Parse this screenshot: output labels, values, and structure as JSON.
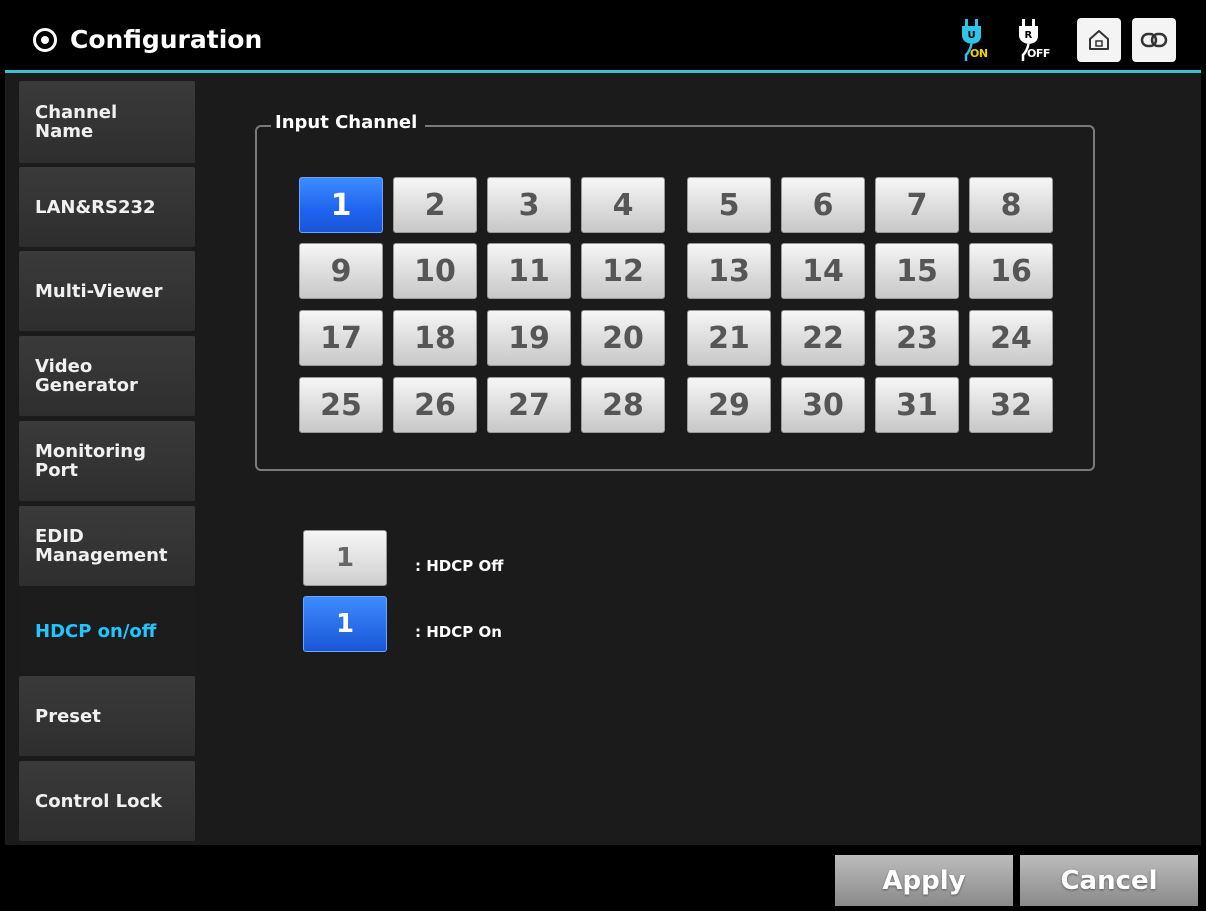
{
  "header": {
    "title": "Configuration",
    "power_on_label": "ON",
    "power_off_label": "OFF",
    "power_on_badge": "U",
    "power_off_badge": "R"
  },
  "sidebar": {
    "items": [
      {
        "line1": "Channel",
        "line2": "Name",
        "active": false
      },
      {
        "line1": "LAN&RS232",
        "line2": "",
        "active": false
      },
      {
        "line1": "Multi-Viewer",
        "line2": "",
        "active": false
      },
      {
        "line1": "Video",
        "line2": "Generator",
        "active": false
      },
      {
        "line1": "Monitoring",
        "line2": "Port",
        "active": false
      },
      {
        "line1": "EDID",
        "line2": "Management",
        "active": false
      },
      {
        "line1": "HDCP on/off",
        "line2": "",
        "active": true
      },
      {
        "line1": "Preset",
        "line2": "",
        "active": false
      },
      {
        "line1": "Control Lock",
        "line2": "",
        "active": false
      }
    ]
  },
  "input_channel": {
    "title": "Input Channel",
    "channels": [
      {
        "label": "1",
        "on": true
      },
      {
        "label": "2",
        "on": false
      },
      {
        "label": "3",
        "on": false
      },
      {
        "label": "4",
        "on": false
      },
      {
        "label": "5",
        "on": false
      },
      {
        "label": "6",
        "on": false
      },
      {
        "label": "7",
        "on": false
      },
      {
        "label": "8",
        "on": false
      },
      {
        "label": "9",
        "on": false
      },
      {
        "label": "10",
        "on": false
      },
      {
        "label": "11",
        "on": false
      },
      {
        "label": "12",
        "on": false
      },
      {
        "label": "13",
        "on": false
      },
      {
        "label": "14",
        "on": false
      },
      {
        "label": "15",
        "on": false
      },
      {
        "label": "16",
        "on": false
      },
      {
        "label": "17",
        "on": false
      },
      {
        "label": "18",
        "on": false
      },
      {
        "label": "19",
        "on": false
      },
      {
        "label": "20",
        "on": false
      },
      {
        "label": "21",
        "on": false
      },
      {
        "label": "22",
        "on": false
      },
      {
        "label": "23",
        "on": false
      },
      {
        "label": "24",
        "on": false
      },
      {
        "label": "25",
        "on": false
      },
      {
        "label": "26",
        "on": false
      },
      {
        "label": "27",
        "on": false
      },
      {
        "label": "28",
        "on": false
      },
      {
        "label": "29",
        "on": false
      },
      {
        "label": "30",
        "on": false
      },
      {
        "label": "31",
        "on": false
      },
      {
        "label": "32",
        "on": false
      }
    ]
  },
  "legend": {
    "off_sample": "1",
    "off_text": ": HDCP Off",
    "on_sample": "1",
    "on_text": ": HDCP On"
  },
  "footer": {
    "apply_label": "Apply",
    "cancel_label": "Cancel"
  },
  "colors": {
    "accent_active": "#22c6ff",
    "channel_on": "#1e63f0",
    "power_on_icon": "#2ec4e8",
    "power_on_text": "#f2d200"
  }
}
